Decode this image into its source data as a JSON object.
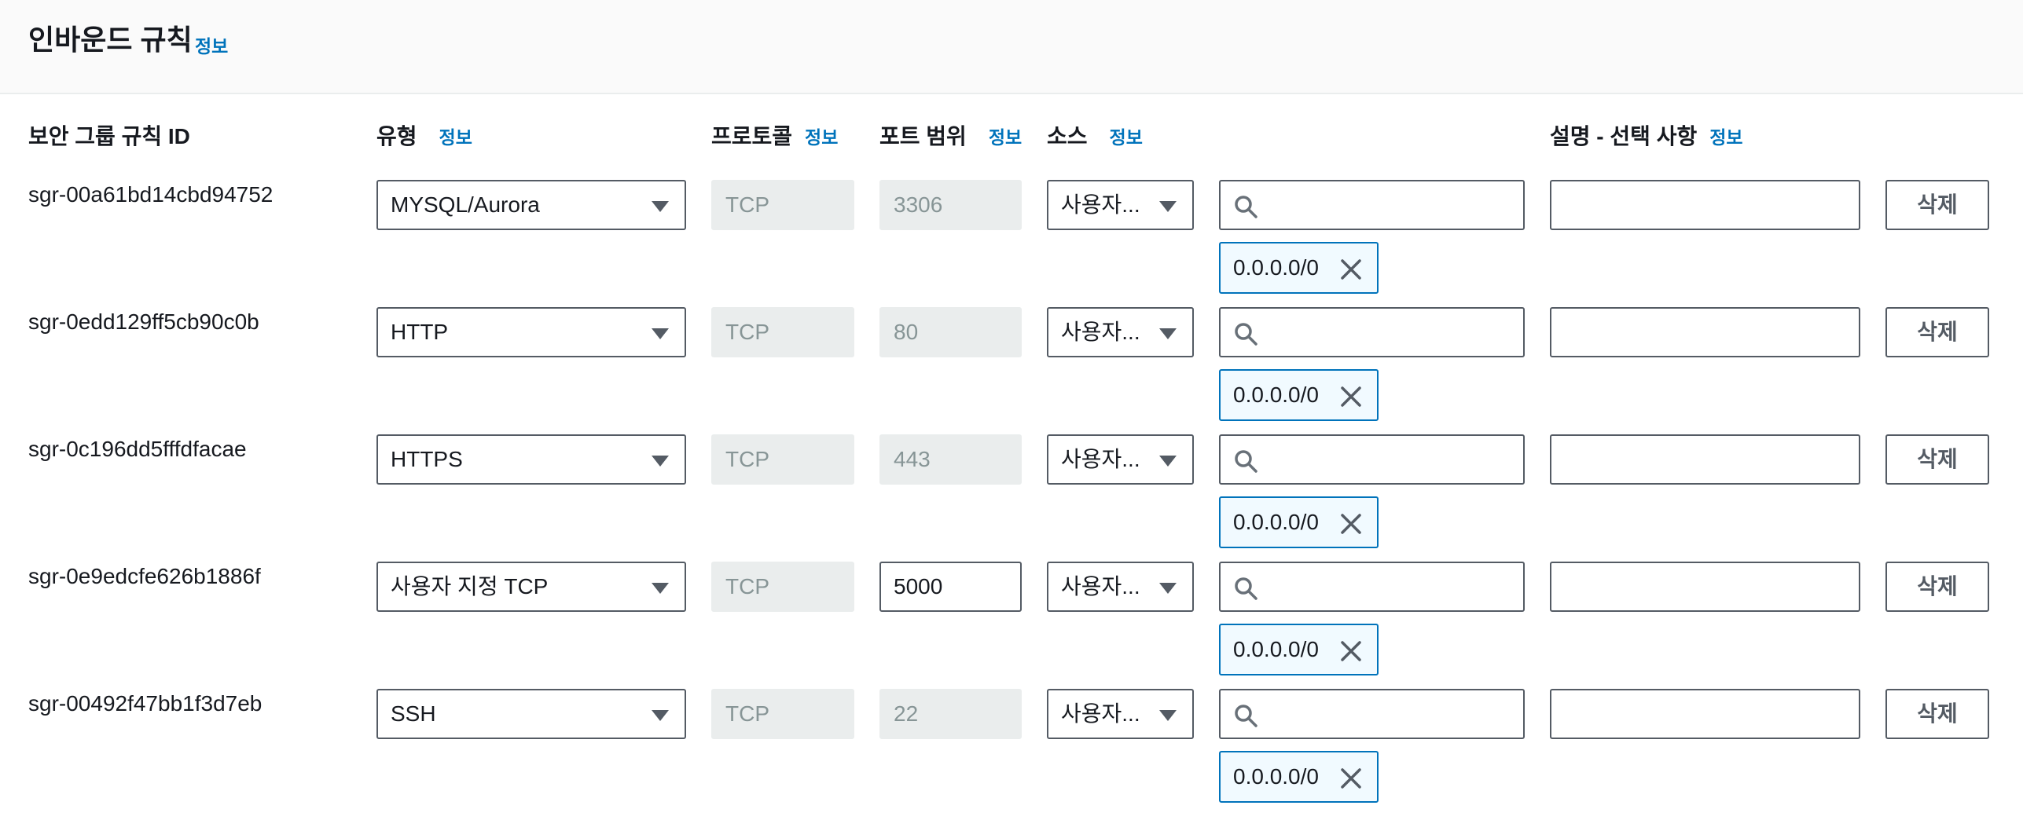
{
  "header": {
    "title": "인바운드 규칙",
    "info": "정보"
  },
  "columns": {
    "id": "보안 그룹 규칙 ID",
    "type": "유형",
    "type_info": "정보",
    "protocol": "프로토콜",
    "protocol_info": "정보",
    "port": "포트 범위",
    "port_info": "정보",
    "source": "소스",
    "source_info": "정보",
    "description": "설명 - 선택 사항",
    "description_info": "정보"
  },
  "rules": [
    {
      "id": "sgr-00a61bd14cbd94752",
      "type": "MYSQL/Aurora",
      "protocol": "TCP",
      "port": "3306",
      "port_editable": false,
      "source": "사용자...",
      "cidr": "0.0.0.0/0",
      "description": "",
      "delete": "삭제"
    },
    {
      "id": "sgr-0edd129ff5cb90c0b",
      "type": "HTTP",
      "protocol": "TCP",
      "port": "80",
      "port_editable": false,
      "source": "사용자...",
      "cidr": "0.0.0.0/0",
      "description": "",
      "delete": "삭제"
    },
    {
      "id": "sgr-0c196dd5fffdfacae",
      "type": "HTTPS",
      "protocol": "TCP",
      "port": "443",
      "port_editable": false,
      "source": "사용자...",
      "cidr": "0.0.0.0/0",
      "description": "",
      "delete": "삭제"
    },
    {
      "id": "sgr-0e9edcfe626b1886f",
      "type": "사용자 지정 TCP",
      "protocol": "TCP",
      "port": "5000",
      "port_editable": true,
      "source": "사용자...",
      "cidr": "0.0.0.0/0",
      "description": "",
      "delete": "삭제"
    },
    {
      "id": "sgr-00492f47bb1f3d7eb",
      "type": "SSH",
      "protocol": "TCP",
      "port": "22",
      "port_editable": false,
      "source": "사용자...",
      "cidr": "0.0.0.0/0",
      "description": "",
      "delete": "삭제"
    }
  ],
  "colors": {
    "link": "#0073bb",
    "token_border": "#0073bb",
    "disabled_bg": "#eaeded"
  },
  "icons": {
    "dropdown": "caret-down-icon",
    "search": "search-icon",
    "remove": "close-icon"
  }
}
